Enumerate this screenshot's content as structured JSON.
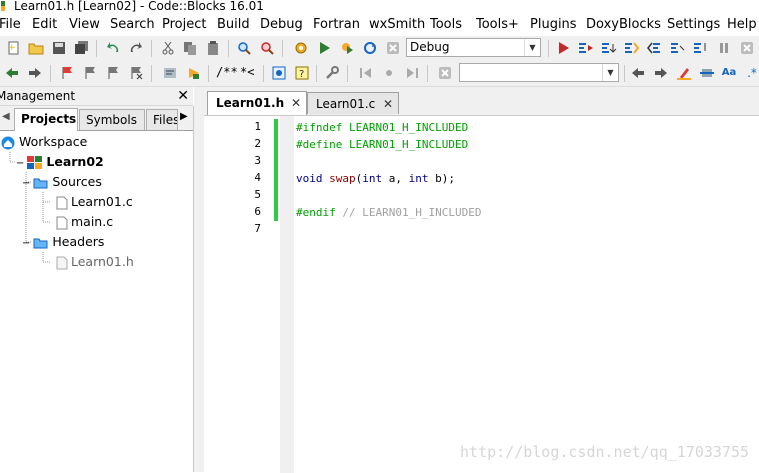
{
  "window": {
    "title": "Learn01.h [Learn02] - Code::Blocks 16.01"
  },
  "menu": [
    "File",
    "Edit",
    "View",
    "Search",
    "Project",
    "Build",
    "Debug",
    "Fortran",
    "wxSmith",
    "Tools",
    "Tools+",
    "Plugins",
    "DoxyBlocks",
    "Settings",
    "Help"
  ],
  "toolbar": {
    "build_target": "Debug",
    "doxy_comment": "/**",
    "doxy_line_comment": "*<",
    "search_value": ""
  },
  "management": {
    "title": "Management",
    "close": "✕"
  },
  "panel_tabs": [
    "Projects",
    "Symbols",
    "Files"
  ],
  "tree": {
    "workspace": "Workspace",
    "project": "Learn02",
    "sources": "Sources",
    "headers": "Headers",
    "source_files": [
      "Learn01.c",
      "main.c"
    ],
    "header_files": [
      "Learn01.h"
    ]
  },
  "editor": {
    "tabs": [
      {
        "label": "Learn01.h",
        "active": true
      },
      {
        "label": "Learn01.c",
        "active": false
      }
    ],
    "line_numbers": [
      "1",
      "2",
      "3",
      "4",
      "5",
      "6",
      "7"
    ],
    "code": {
      "l1": "#ifndef LEARN01_H_INCLUDED",
      "l2": "#define LEARN01_H_INCLUDED",
      "l4_kw1": "void",
      "l4_fn": "swap",
      "l4_p1": "(",
      "l4_kw2": "int",
      "l4_v1": " a, ",
      "l4_kw3": "int",
      "l4_v2": " b);",
      "l6_pp": "#endif",
      "l6_cm": " // LEARN01_H_INCLUDED"
    }
  },
  "watermark": "http://blog.csdn.net/qq_17033755",
  "colors": {
    "change_bar": "#2ecc40",
    "preprocessor": "#00a000",
    "keyword": "#00008b",
    "comment": "#a0a0a0"
  }
}
